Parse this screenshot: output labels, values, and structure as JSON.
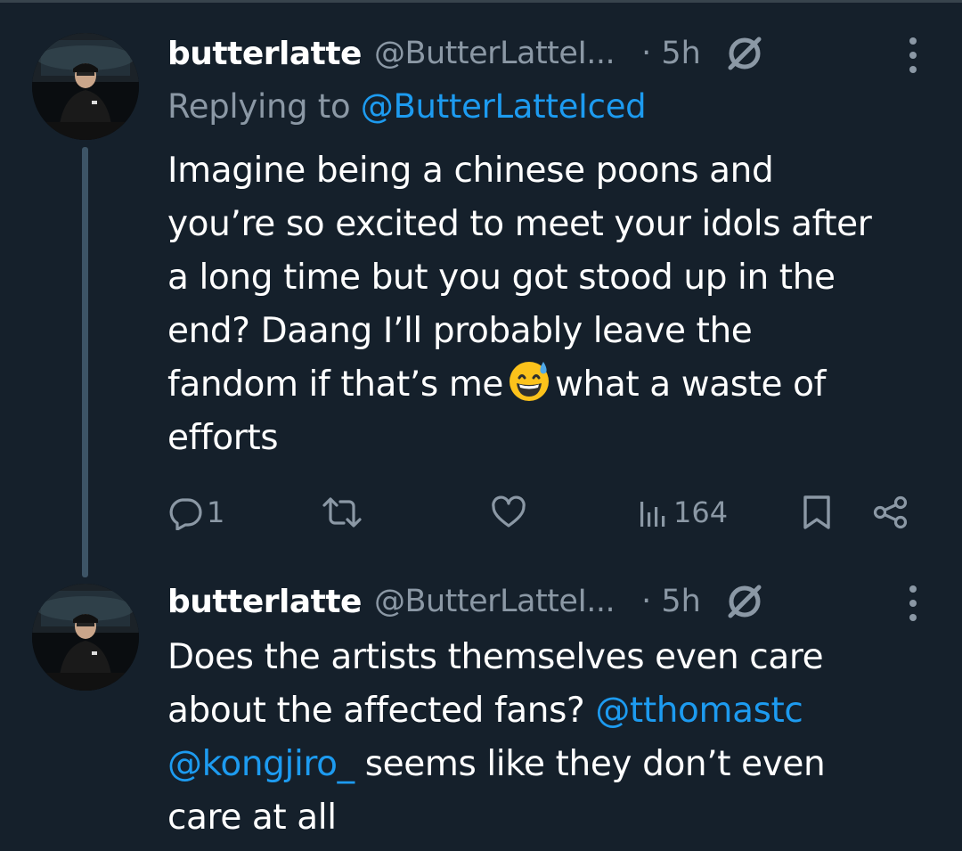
{
  "tweets": [
    {
      "author": {
        "display_name": "butterlatte",
        "handle": "@ButterLatteI...",
        "avatar_icon": "avatar-photo"
      },
      "time": "· 5h",
      "reply_prefix": "Replying to ",
      "reply_to": "@ButterLatteIced",
      "body_lines": [
        "Imagine being a chinese poons and",
        "you’re so excited to meet your idols after",
        "a long time but you got stood up in the",
        "end? Daang I’ll probably leave the",
        "fandom if that’s me",
        "what a waste of",
        "efforts"
      ],
      "emoji": "grinning-face-with-sweat",
      "actions": {
        "reply_count": "1",
        "retweet_count": "",
        "like_count": "",
        "views_count": "164"
      }
    },
    {
      "author": {
        "display_name": "butterlatte",
        "handle": "@ButterLatteI...",
        "avatar_icon": "avatar-photo"
      },
      "time": "· 5h",
      "body_lines": [
        "Does the artists themselves even care",
        "about the affected fans?",
        "@tthomastc",
        "@kongjiro_",
        "seems like they don’t even",
        "care at all"
      ]
    }
  ],
  "colors": {
    "background": "#15202b",
    "text_primary": "#ffffff",
    "text_secondary": "#8b98a5",
    "link": "#1d9bf0",
    "thread_line": "#3d5466"
  }
}
